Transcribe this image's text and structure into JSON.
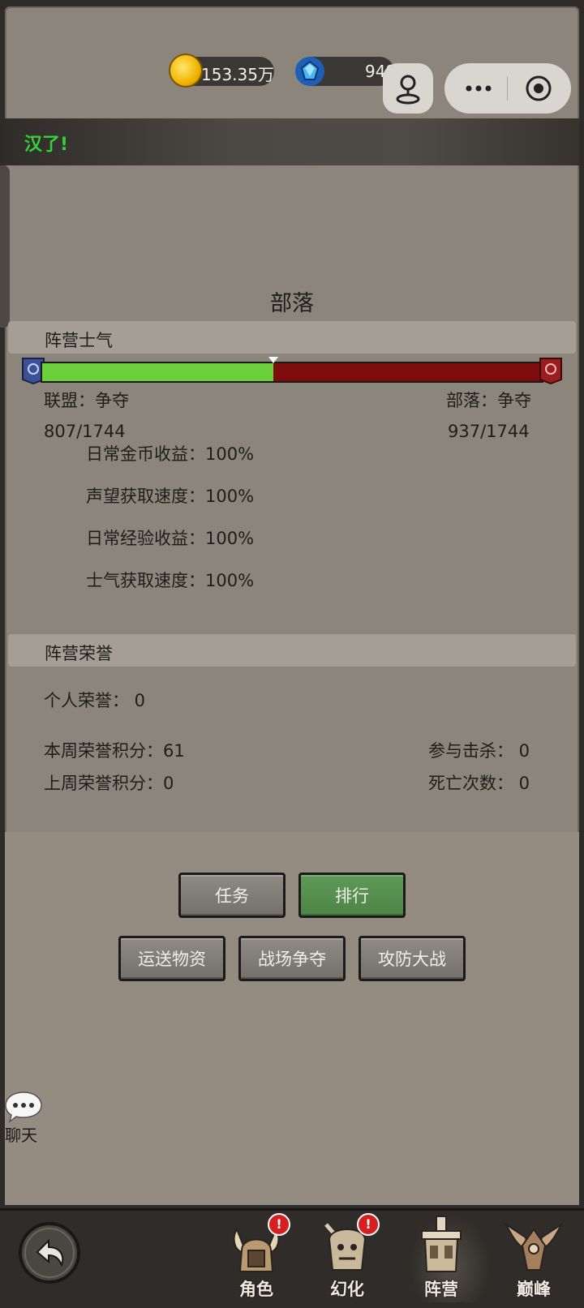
{
  "top_bar": {
    "gold": "153.35万",
    "gems": "949"
  },
  "banner": {
    "text": "汉了!"
  },
  "faction": {
    "title": "部落"
  },
  "morale": {
    "heading": "阵营士气",
    "alliance_label": "联盟：争夺",
    "horde_label": "部落：争夺",
    "alliance_score": "807/1744",
    "horde_score": "937/1744",
    "alliance_fraction": 0.463,
    "colors": {
      "alliance": "#6ccf3c",
      "horde": "#7f0c0c"
    },
    "bonuses": [
      "日常金币收益：100%",
      "声望获取速度：100%",
      "日常经验收益：100%",
      "士气获取速度：100%"
    ]
  },
  "honor": {
    "heading": "阵营荣誉",
    "personal": "个人荣誉：  0",
    "this_week": "本周荣誉积分：61",
    "last_week": "上周荣誉积分：0",
    "kills": "参与击杀：  0",
    "deaths": "死亡次数：  0"
  },
  "buttons": {
    "tasks": "任务",
    "ranking": "排行",
    "transport": "运送物资",
    "battlefield": "战场争夺",
    "siege": "攻防大战"
  },
  "chat": {
    "label": "聊天"
  },
  "nav": {
    "items": [
      {
        "label": "角色",
        "badge": "!",
        "icon": "viking-helmet-icon"
      },
      {
        "label": "幻化",
        "badge": "!",
        "icon": "demon-head-icon"
      },
      {
        "label": "阵营",
        "icon": "fortress-tower-icon",
        "active": true
      },
      {
        "label": "巅峰",
        "icon": "winged-crest-icon"
      }
    ]
  }
}
